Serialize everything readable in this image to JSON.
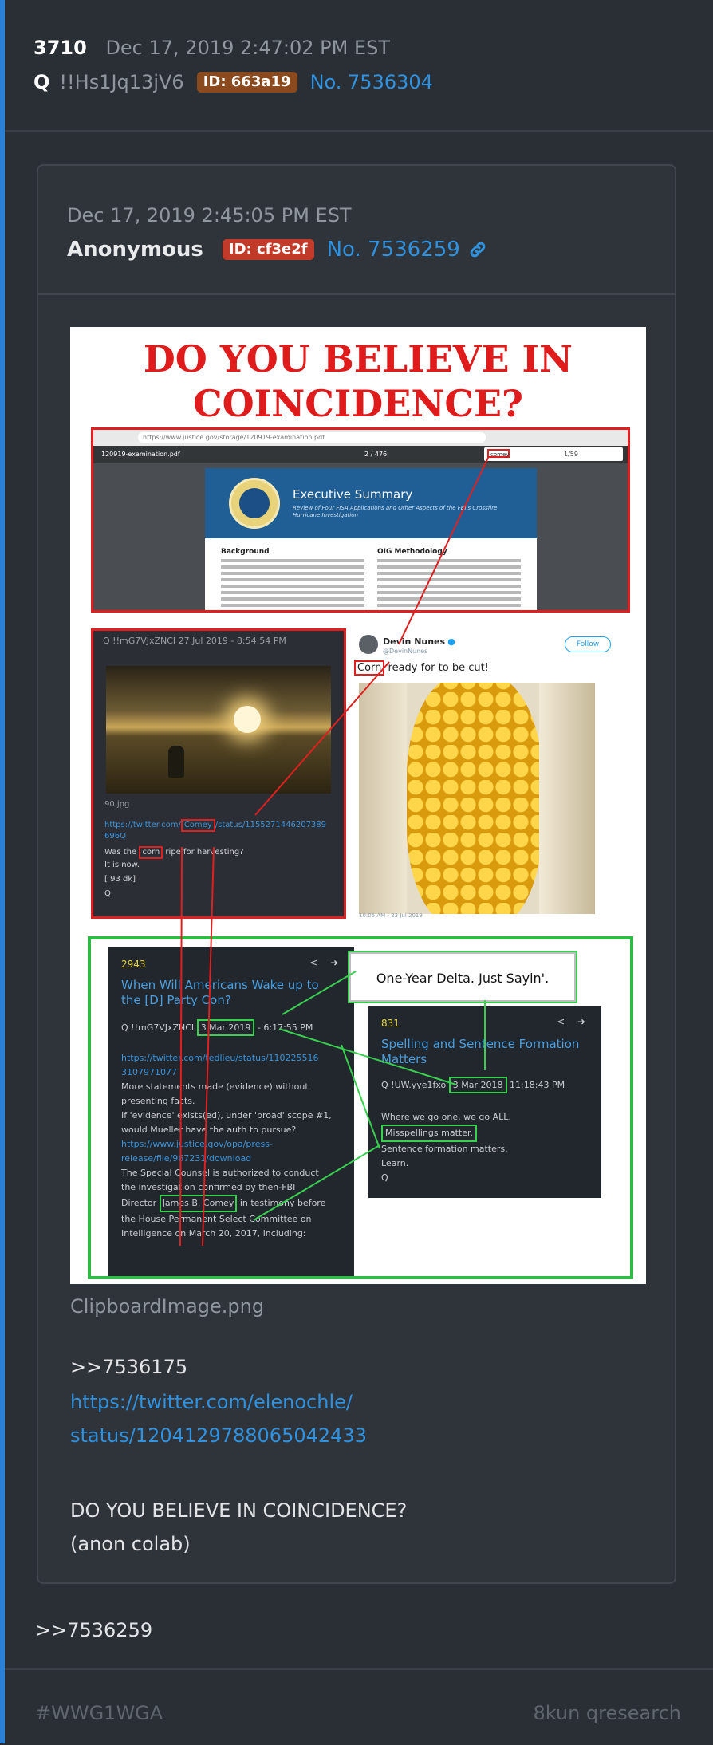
{
  "post": {
    "number": "3710",
    "timestamp": "Dec 17, 2019 2:47:02 PM EST",
    "name": "Q",
    "tripcode": "!!Hs1Jq13jV6",
    "id_badge": "ID: 663a19",
    "post_link": "No. 7536304",
    "reply_ref": ">>7536259"
  },
  "quoted": {
    "timestamp": "Dec 17, 2019 2:45:05 PM EST",
    "name": "Anonymous",
    "id_badge": "ID: cf3e2f",
    "post_link": "No. 7536259",
    "image_filename": "ClipboardImage.png",
    "ref": ">>7536175",
    "twitter_link_1": "https://twitter.com/elenochle/",
    "twitter_link_2": "status/1204129788065042433",
    "text_1": "DO YOU BELIEVE IN COINCIDENCE?",
    "text_2": "(anon colab)"
  },
  "image": {
    "title_line1": "DO YOU BELIEVE IN",
    "title_line2": "COINCIDENCE?",
    "browser": {
      "url": "https://www.justice.gov/storage/120919-examination.pdf",
      "pdf_name": "120919-examination.pdf",
      "pdf_page": "2 / 476",
      "find_text": "comey",
      "find_count": "1/59",
      "banner_title": "Executive Summary",
      "banner_sub": "Review of Four FISA Applications and Other Aspects of the FBI's Crossfire Hurricane Investigation",
      "col1_heading": "Background",
      "col2_heading": "OIG Methodology"
    },
    "left_post": {
      "header": "Q  !!mG7VJxZNCI  27 Jul 2019 - 8:54:54 PM",
      "file": "90.jpg",
      "link_prefix": "https://twitter.com/",
      "link_hl": "Comey",
      "link_suffix": "/status/1155271446207389",
      "link_line2": "696Q",
      "line_prefix": "Was the ",
      "line_hl": "corn",
      "line_suffix": " ripe for harvesting?",
      "line2": "It is now.",
      "line3": "[     93        dk]",
      "line4": "Q"
    },
    "tweet": {
      "name": "Devin Nunes",
      "handle": "@DevinNunes",
      "follow": "Follow",
      "text_hl": "Corn",
      "text_rest": " ready for to be cut!",
      "footer": "10:05 AM - 23 Jul 2019"
    },
    "delta_box": "One-Year Delta. Just Sayin'.",
    "green_left": {
      "num": "2943",
      "title_1": "When Will Americans Wake up to",
      "title_2": "the [D] Party Con?",
      "meta_prefix": "Q  !!mG7VJxZNCI",
      "meta_hl": "3 Mar 2019",
      "meta_suffix": " - 6:17:55 PM",
      "link1": "https://twitter.com/tedlieu/status/110225516",
      "link1b": "3107971077",
      "b1": "More statements made (evidence) without",
      "b2": "presenting facts.",
      "b3": "If 'evidence' exists(ed), under 'broad' scope #1,",
      "b4": "would Mueller have the auth to pursue?",
      "link2": "https://www.justice.gov/opa/press-",
      "link2b": "release/file/967231/download",
      "b5": "The Special Counsel is authorized to conduct",
      "b6": "the investigation confirmed by then-FBI",
      "b7_prefix": "Director ",
      "b7_hl": "James B. Comey",
      "b7_suffix": " in testimony before",
      "b8": "the House Permanent Select Committee on",
      "b9": "Intelligence on March 20, 2017, including:"
    },
    "green_right": {
      "num": "831",
      "title_1": "Spelling and Sentence Formation",
      "title_2": "Matters",
      "meta_prefix": "Q  !UW.yye1fxo",
      "meta_hl": "3 Mar 2018",
      "meta_suffix": "  11:18:43 PM",
      "b1": "Where we go one, we go ALL.",
      "b2_hl": "Misspellings matter.",
      "b3": "Sentence formation matters.",
      "b4": "Learn.",
      "b5": "Q"
    }
  },
  "footer": {
    "left": "#WWG1WGA",
    "right": "8kun qresearch"
  },
  "colors": {
    "accent": "#2c7fd6",
    "link": "#2f92e0",
    "id_badge_q": "#8a4a1e",
    "id_badge_anon": "#c23b2a",
    "highlight_red": "#e02020",
    "highlight_green": "#38d14f"
  }
}
